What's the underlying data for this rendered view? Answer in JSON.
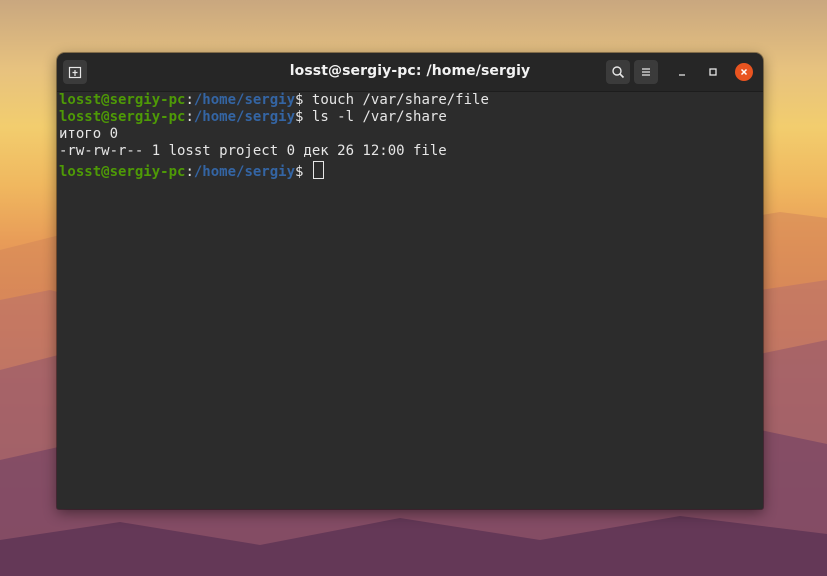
{
  "window": {
    "title": "losst@sergiy-pc: /home/sergiy"
  },
  "titlebar": {
    "buttons": [
      {
        "name": "new-tab",
        "icon": "new-tab-icon"
      },
      {
        "name": "search",
        "icon": "search-icon"
      },
      {
        "name": "menu",
        "icon": "hamburger-menu-icon"
      },
      {
        "name": "minimize",
        "icon": "minimize-icon"
      },
      {
        "name": "maximize",
        "icon": "maximize-icon"
      },
      {
        "name": "close",
        "icon": "close-icon"
      }
    ]
  },
  "terminal": {
    "lines": [
      {
        "user": "losst@sergiy-pc",
        "sep": ":",
        "path": "/home/sergiy",
        "prompt": "$ ",
        "command": "touch /var/share/file"
      },
      {
        "user": "losst@sergiy-pc",
        "sep": ":",
        "path": "/home/sergiy",
        "prompt": "$ ",
        "command": "ls -l /var/share"
      },
      {
        "output": "итого 0"
      },
      {
        "output": "-rw-rw-r-- 1 losst project 0 дек 26 12:00 file"
      },
      {
        "user": "losst@sergiy-pc",
        "sep": ":",
        "path": "/home/sergiy",
        "prompt": "$ ",
        "command": ""
      }
    ]
  },
  "colors": {
    "user": "#4e9a06",
    "path": "#3465a4",
    "text": "#e6e6e6",
    "background": "#2c2c2c",
    "titlebar": "#262626",
    "close_button": "#e95420"
  }
}
